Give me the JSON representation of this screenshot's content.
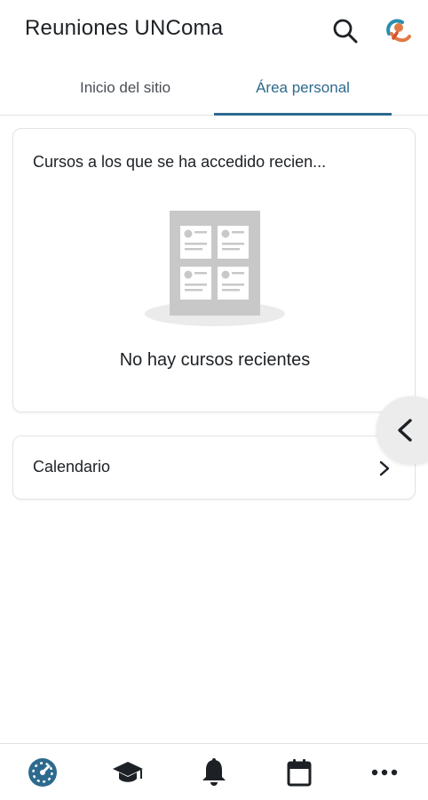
{
  "header": {
    "title": "Reuniones UNComa",
    "search_icon": "search-icon",
    "avatar_icon": "user-avatar"
  },
  "tabs": [
    {
      "label": "Inicio del sitio",
      "active": false
    },
    {
      "label": "Área personal",
      "active": true
    }
  ],
  "recent_courses": {
    "title": "Cursos a los que se ha accedido recien...",
    "empty_message": "No hay cursos recientes",
    "illustration": "empty-courses-illustration"
  },
  "calendar_card": {
    "label": "Calendario",
    "icon": "chevron-right-icon"
  },
  "drawer_toggle": {
    "icon": "chevron-left-icon"
  },
  "bottom_nav": [
    {
      "name": "dashboard",
      "icon": "dashboard-icon",
      "active": true
    },
    {
      "name": "courses",
      "icon": "graduation-cap-icon",
      "active": false
    },
    {
      "name": "notifications",
      "icon": "bell-icon",
      "active": false
    },
    {
      "name": "calendar",
      "icon": "calendar-icon",
      "active": false
    },
    {
      "name": "more",
      "icon": "more-icon",
      "active": false
    }
  ],
  "colors": {
    "accent": "#2d6a8e",
    "text": "#1d2125",
    "divider": "#dfe1e3"
  }
}
